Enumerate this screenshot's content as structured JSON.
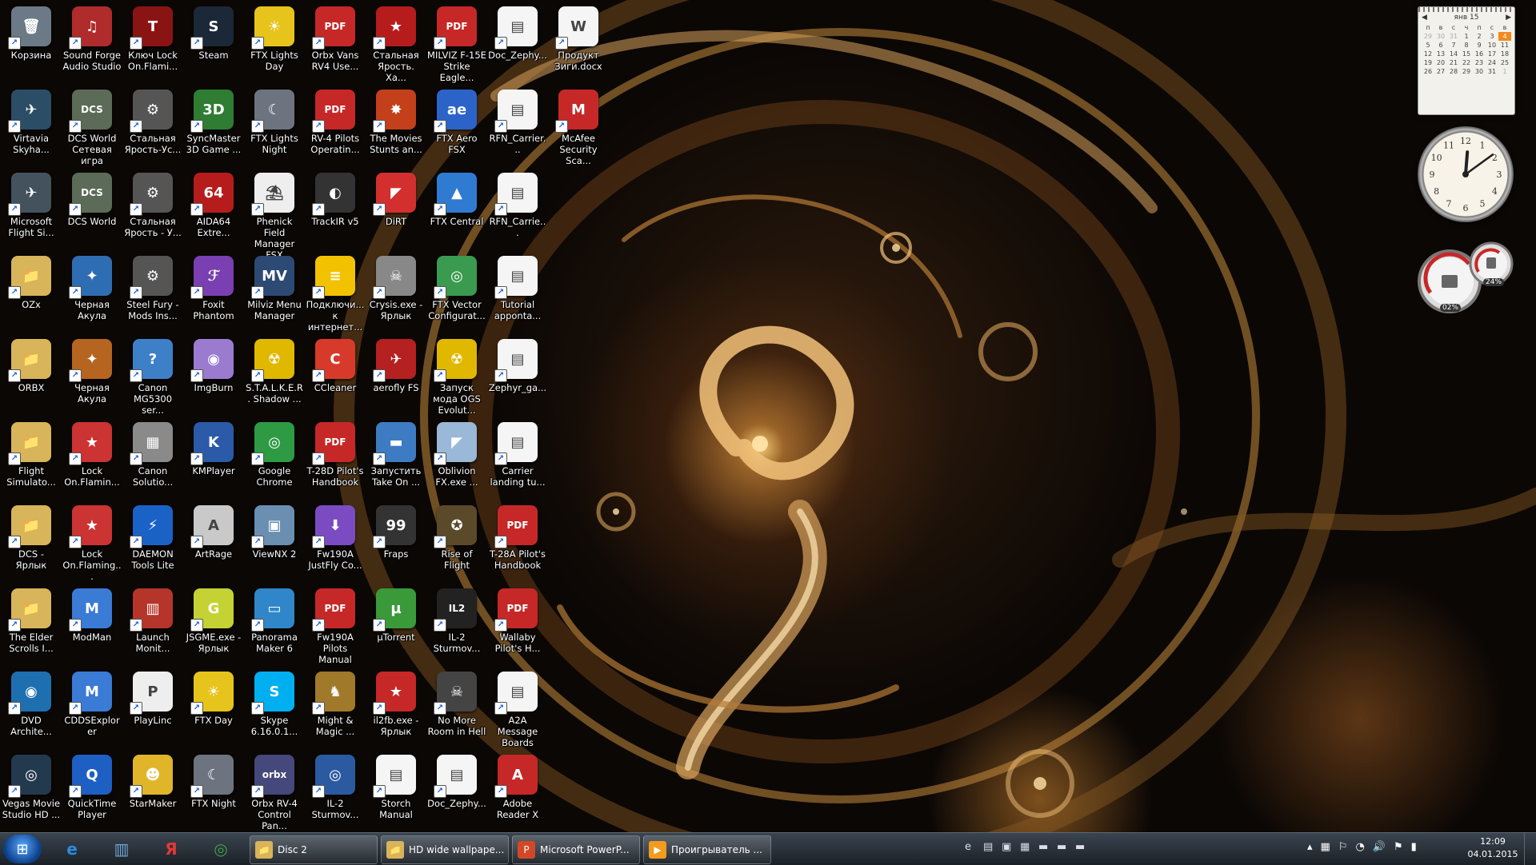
{
  "desktop": {
    "columns": [
      [
        {
          "label": "Корзина",
          "icon": "recycle-bin-icon",
          "glyph": "🗑",
          "color": "#6b7a86"
        },
        {
          "label": "Virtavia Skyha...",
          "icon": "virtavia-icon",
          "glyph": "✈",
          "color": "#2b4d66"
        },
        {
          "label": "Microsoft Flight Si...",
          "icon": "flight-simulator-icon",
          "glyph": "✈",
          "color": "#44525e"
        },
        {
          "label": "OZx",
          "icon": "folder-icon",
          "glyph": "📁",
          "color": "#d8b45a"
        },
        {
          "label": "ORBX",
          "icon": "folder-icon",
          "glyph": "📁",
          "color": "#d8b45a"
        },
        {
          "label": "Flight Simulato...",
          "icon": "folder-icon",
          "glyph": "📁",
          "color": "#d8b45a"
        },
        {
          "label": "DCS - Ярлык",
          "icon": "folder-icon",
          "glyph": "📁",
          "color": "#d8b45a"
        },
        {
          "label": "The Elder Scrolls I...",
          "icon": "folder-icon",
          "glyph": "📁",
          "color": "#d8b45a"
        },
        {
          "label": "DVD Archite...",
          "icon": "dvd-icon",
          "glyph": "◉",
          "color": "#1e6fb0"
        },
        {
          "label": "Vegas Movie Studio HD ...",
          "icon": "vegas-icon",
          "glyph": "◎",
          "color": "#233a4e"
        }
      ],
      [
        {
          "label": "Sound Forge Audio Studio",
          "icon": "sound-forge-icon",
          "glyph": "♫",
          "color": "#b02b2b"
        },
        {
          "label": "DCS World Сетевая игра",
          "icon": "dcs-icon",
          "glyph": "DCS",
          "color": "#5c6b57"
        },
        {
          "label": "DCS World",
          "icon": "dcs-icon",
          "glyph": "DCS",
          "color": "#5c6b57"
        },
        {
          "label": "Черная Акула",
          "icon": "helicopter-icon",
          "glyph": "✦",
          "color": "#2f6db3"
        },
        {
          "label": "Черная Акула",
          "icon": "helicopter-icon",
          "glyph": "✦",
          "color": "#b5651f"
        },
        {
          "label": "Lock On.Flamin...",
          "icon": "lock-on-icon",
          "glyph": "★",
          "color": "#c33"
        },
        {
          "label": "Lock On.Flaming...",
          "icon": "lock-on-icon",
          "glyph": "★",
          "color": "#c33"
        },
        {
          "label": "ModMan",
          "icon": "modman-icon",
          "glyph": "M",
          "color": "#3a7bd5"
        },
        {
          "label": "CDDSExplorer",
          "icon": "modman-icon",
          "glyph": "M",
          "color": "#3a7bd5"
        },
        {
          "label": "QuickTime Player",
          "icon": "quicktime-icon",
          "glyph": "Q",
          "color": "#1e5fc4"
        }
      ],
      [
        {
          "label": "Ключ Lock On.Flami...",
          "icon": "key-icon",
          "glyph": "T",
          "color": "#8a1414"
        },
        {
          "label": "Стальная Ярость-Ус...",
          "icon": "gear-icon",
          "glyph": "⚙",
          "color": "#555"
        },
        {
          "label": "Стальная Ярость - У...",
          "icon": "gear-icon",
          "glyph": "⚙",
          "color": "#555"
        },
        {
          "label": "Steel Fury - Mods Ins...",
          "icon": "gear-icon",
          "glyph": "⚙",
          "color": "#555"
        },
        {
          "label": "Canon MG5300 ser...",
          "icon": "help-icon",
          "glyph": "?",
          "color": "#3d80c8"
        },
        {
          "label": "Canon Solutio...",
          "icon": "canon-icon",
          "glyph": "▦",
          "color": "#8a8a8a"
        },
        {
          "label": "DAEMON Tools Lite",
          "icon": "daemon-tools-icon",
          "glyph": "⚡",
          "color": "#1b62c7"
        },
        {
          "label": "Launch Monit...",
          "icon": "monitor-icon",
          "glyph": "▥",
          "color": "#b5352b"
        },
        {
          "label": "PlayLinc",
          "icon": "playlinc-icon",
          "glyph": "P",
          "color": "#eee"
        },
        {
          "label": "StarMaker",
          "icon": "starmaker-icon",
          "glyph": "☻",
          "color": "#e0b52a"
        }
      ],
      [
        {
          "label": "Steam",
          "icon": "steam-icon",
          "glyph": "S",
          "color": "#1b2838"
        },
        {
          "label": "SyncMaster 3D Game ...",
          "icon": "syncmaster-icon",
          "glyph": "3D",
          "color": "#2e7d32"
        },
        {
          "label": "AIDA64 Extre...",
          "icon": "aida64-icon",
          "glyph": "64",
          "color": "#b71c1c"
        },
        {
          "label": "Foxit Phantom",
          "icon": "foxit-icon",
          "glyph": "ℱ",
          "color": "#7a3fb0"
        },
        {
          "label": "ImgBurn",
          "icon": "imgburn-icon",
          "glyph": "◉",
          "color": "#9a7bd0"
        },
        {
          "label": "KMPlayer",
          "icon": "kmplayer-icon",
          "glyph": "K",
          "color": "#2a5aa8"
        },
        {
          "label": "ArtRage",
          "icon": "artrage-icon",
          "glyph": "A",
          "color": "#c9c9c9"
        },
        {
          "label": "JSGME.exe - Ярлык",
          "icon": "jsgme-icon",
          "glyph": "G",
          "color": "#c4d233"
        },
        {
          "label": "FTX Day",
          "icon": "ftx-day-icon",
          "glyph": "☀",
          "color": "#e7c41b"
        },
        {
          "label": "FTX Night",
          "icon": "ftx-night-icon",
          "glyph": "☾",
          "color": "#6d7480"
        }
      ],
      [
        {
          "label": "FTX Lights Day",
          "icon": "ftx-day-icon",
          "glyph": "☀",
          "color": "#e7c41b"
        },
        {
          "label": "FTX Lights Night",
          "icon": "ftx-night-icon",
          "glyph": "☾",
          "color": "#6d7480"
        },
        {
          "label": "Phenick Field Manager FSX",
          "icon": "document-icon",
          "glyph": "⛱",
          "color": "#eee"
        },
        {
          "label": "Milviz Menu Manager",
          "icon": "milviz-icon",
          "glyph": "MV",
          "color": "#2c4a73"
        },
        {
          "label": "S.T.A.L.K.E.R. Shadow ...",
          "icon": "radiation-icon",
          "glyph": "☢",
          "color": "#e0b800"
        },
        {
          "label": "Google Chrome",
          "icon": "chrome-icon",
          "glyph": "◎",
          "color": "#2e9a44"
        },
        {
          "label": "ViewNX 2",
          "icon": "viewnx-icon",
          "glyph": "▣",
          "color": "#6a8fb0"
        },
        {
          "label": "Panorama Maker 6",
          "icon": "panorama-icon",
          "glyph": "▭",
          "color": "#2f87c9"
        },
        {
          "label": "Skype 6.16.0.1...",
          "icon": "skype-icon",
          "glyph": "S",
          "color": "#00aff0"
        },
        {
          "label": "Orbx RV-4 Control Pan...",
          "icon": "orbx-icon",
          "glyph": "orbx",
          "color": "#44487a"
        }
      ],
      [
        {
          "label": "Orbx Vans RV4 Use...",
          "icon": "pdf-icon",
          "glyph": "PDF",
          "color": "#c62828"
        },
        {
          "label": "RV-4 Pilots Operatin...",
          "icon": "pdf-icon",
          "glyph": "PDF",
          "color": "#c62828"
        },
        {
          "label": "TrackIR v5",
          "icon": "trackir-icon",
          "glyph": "◐",
          "color": "#333"
        },
        {
          "label": "Подключи... к интернет...",
          "icon": "beeline-icon",
          "glyph": "≡",
          "color": "#f2c200"
        },
        {
          "label": "CCleaner",
          "icon": "ccleaner-icon",
          "glyph": "C",
          "color": "#d73a2a"
        },
        {
          "label": "T-28D Pilot's Handbook",
          "icon": "pdf-icon",
          "glyph": "PDF",
          "color": "#c62828"
        },
        {
          "label": "Fw190A JustFly Co...",
          "icon": "installer-icon",
          "glyph": "⬇",
          "color": "#7b4bc2"
        },
        {
          "label": "Fw190A Pilots Manual",
          "icon": "pdf-icon",
          "glyph": "PDF",
          "color": "#c62828"
        },
        {
          "label": "Might & Magic ...",
          "icon": "griffin-icon",
          "glyph": "♞",
          "color": "#a07a2a"
        },
        {
          "label": "IL-2 Sturmov...",
          "icon": "il2-icon",
          "glyph": "◎",
          "color": "#2c5aa0"
        }
      ],
      [
        {
          "label": "Стальная Ярость. Ха...",
          "icon": "soviet-star-icon",
          "glyph": "★",
          "color": "#b71c1c"
        },
        {
          "label": "The Movies Stunts an...",
          "icon": "movies-icon",
          "glyph": "✸",
          "color": "#c4401a"
        },
        {
          "label": "DiRT",
          "icon": "dirt-icon",
          "glyph": "◤",
          "color": "#d32f2f"
        },
        {
          "label": "Crysis.exe - Ярлык",
          "icon": "crysis-icon",
          "glyph": "☠",
          "color": "#888"
        },
        {
          "label": "aerofly FS",
          "icon": "aerofly-icon",
          "glyph": "✈",
          "color": "#b52020"
        },
        {
          "label": "Запустить Take On ...",
          "icon": "take-on-icon",
          "glyph": "▬",
          "color": "#3d7cc2"
        },
        {
          "label": "Fraps",
          "icon": "fraps-icon",
          "glyph": "99",
          "color": "#333"
        },
        {
          "label": "µTorrent",
          "icon": "utorrent-icon",
          "glyph": "µ",
          "color": "#3a9a3a"
        },
        {
          "label": "il2fb.exe - Ярлык",
          "icon": "il2fb-icon",
          "glyph": "★",
          "color": "#c62828"
        },
        {
          "label": "Storch Manual",
          "icon": "document-icon",
          "glyph": "▤",
          "color": "#f5f5f5"
        }
      ],
      [
        {
          "label": "MILVIZ F-15E Strike Eagle...",
          "icon": "pdf-icon",
          "glyph": "PDF",
          "color": "#c62828"
        },
        {
          "label": "FTX Aero FSX",
          "icon": "ftx-aero-icon",
          "glyph": "ae",
          "color": "#2b63c9"
        },
        {
          "label": "FTX Central",
          "icon": "ftx-central-icon",
          "glyph": "▲",
          "color": "#2f7bd1"
        },
        {
          "label": "FTX Vector Configurat...",
          "icon": "ftx-vector-icon",
          "glyph": "◎",
          "color": "#3a9a4f"
        },
        {
          "label": "Запуск мода OGS Evolut...",
          "icon": "radiation-icon",
          "glyph": "☢",
          "color": "#e0b800"
        },
        {
          "label": "Oblivion FX.exe ...",
          "icon": "oblivion-icon",
          "glyph": "◤",
          "color": "#9ab8d8"
        },
        {
          "label": "Rise of Flight",
          "icon": "rise-of-flight-icon",
          "glyph": "✪",
          "color": "#5a4a2a"
        },
        {
          "label": "IL-2 Sturmov...",
          "icon": "il2-icon",
          "glyph": "IL2",
          "color": "#222"
        },
        {
          "label": "No More Room in Hell",
          "icon": "skull-icon",
          "glyph": "☠",
          "color": "#444"
        },
        {
          "label": "Doc_Zephy...",
          "icon": "document-icon",
          "glyph": "▤",
          "color": "#f5f5f5"
        }
      ],
      [
        {
          "label": "Doc_Zephy...",
          "icon": "document-icon",
          "glyph": "▤",
          "color": "#f5f5f5"
        },
        {
          "label": "RFN_Carrier...",
          "icon": "document-icon",
          "glyph": "▤",
          "color": "#f5f5f5"
        },
        {
          "label": "RFN_Carrie...",
          "icon": "document-icon",
          "glyph": "▤",
          "color": "#f5f5f5"
        },
        {
          "label": "Tutorial apponta...",
          "icon": "document-icon",
          "glyph": "▤",
          "color": "#f5f5f5"
        },
        {
          "label": "Zephyr_ga...",
          "icon": "document-icon",
          "glyph": "▤",
          "color": "#f5f5f5"
        },
        {
          "label": "Carrier landing tu...",
          "icon": "document-icon",
          "glyph": "▤",
          "color": "#f5f5f5"
        },
        {
          "label": "T-28A Pilot's Handbook",
          "icon": "pdf-icon",
          "glyph": "PDF",
          "color": "#c62828"
        },
        {
          "label": "Wallaby Pilot's H...",
          "icon": "pdf-icon",
          "glyph": "PDF",
          "color": "#c62828"
        },
        {
          "label": "A2A Message Boards",
          "icon": "document-icon",
          "glyph": "▤",
          "color": "#f5f5f5"
        },
        {
          "label": "Adobe Reader X",
          "icon": "adobe-reader-icon",
          "glyph": "A",
          "color": "#c62828"
        }
      ],
      [
        {
          "label": "Продукт Зиги.docx",
          "icon": "word-doc-icon",
          "glyph": "W",
          "color": "#f5f5f5"
        },
        {
          "label": "McAfee Security Sca...",
          "icon": "mcafee-icon",
          "glyph": "M",
          "color": "#c62828"
        }
      ]
    ]
  },
  "gadgets": {
    "calendar": {
      "month": "янв 15",
      "prev": "◀",
      "next": "▶",
      "weekdays": [
        "п",
        "в",
        "с",
        "ч",
        "п",
        "с",
        "в"
      ],
      "weeks": [
        [
          "29",
          "30",
          "31",
          "1",
          "2",
          "3",
          "4"
        ],
        [
          "5",
          "6",
          "7",
          "8",
          "9",
          "10",
          "11"
        ],
        [
          "12",
          "13",
          "14",
          "15",
          "16",
          "17",
          "18"
        ],
        [
          "19",
          "20",
          "21",
          "22",
          "23",
          "24",
          "25"
        ],
        [
          "26",
          "27",
          "28",
          "29",
          "30",
          "31",
          "1"
        ]
      ],
      "today": "4"
    },
    "clock": {
      "hour": 12,
      "minute": 9
    },
    "cpu_meter": {
      "cpu": "02%",
      "ram": "24%"
    }
  },
  "taskbar": {
    "pinned": [
      {
        "name": "ie",
        "glyph": "e",
        "color": "#2a8de0"
      },
      {
        "name": "explorer",
        "glyph": "▥",
        "color": "#6fa7d8"
      },
      {
        "name": "yandex",
        "glyph": "Я",
        "color": "#e53935"
      },
      {
        "name": "chrome",
        "glyph": "◎",
        "color": "#43a047"
      }
    ],
    "tasks": [
      {
        "label": "Disc 2",
        "icon": "folder-icon",
        "glyph": "📁",
        "color": "#d8b45a"
      },
      {
        "label": "HD wide wallpape...",
        "icon": "folder-icon",
        "glyph": "📁",
        "color": "#d8b45a"
      },
      {
        "label": "Microsoft PowerP...",
        "icon": "powerpoint-icon",
        "glyph": "P",
        "color": "#d24726"
      },
      {
        "label": "Проигрыватель ...",
        "icon": "media-player-icon",
        "glyph": "▶",
        "color": "#f29b1d"
      }
    ],
    "quicklaunch": [
      "e",
      "▤",
      "▣",
      "▦",
      "▬",
      "▬",
      "▬"
    ],
    "tray": [
      "▴",
      "▦",
      "⚐",
      "◔",
      "🔊",
      "⚑",
      "▮"
    ],
    "time": "12:09",
    "date": "04.01.2015"
  }
}
